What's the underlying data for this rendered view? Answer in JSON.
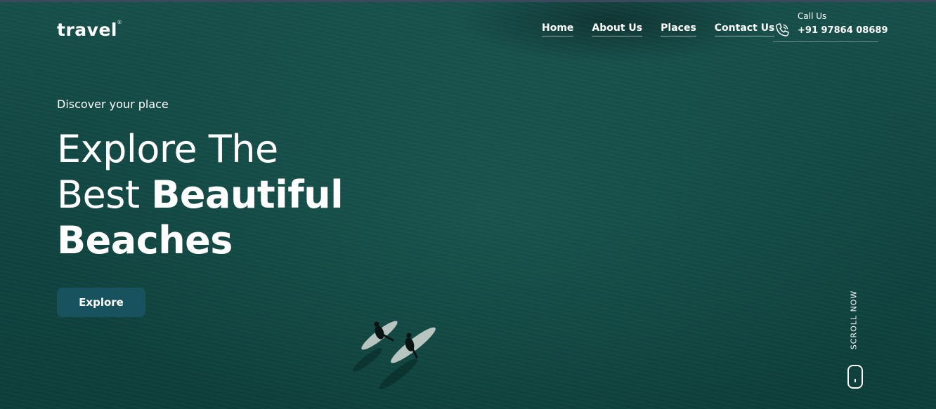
{
  "brand": {
    "logo_text": "travel",
    "registered_mark": "®"
  },
  "nav": {
    "items": [
      {
        "label": "Home"
      },
      {
        "label": "About Us"
      },
      {
        "label": "Places"
      },
      {
        "label": "Contact Us"
      }
    ]
  },
  "contact": {
    "label": "Call Us",
    "phone": "+91 97864 08689"
  },
  "hero": {
    "eyebrow": "Discover your place",
    "headline_line1": "Explore The",
    "headline_line2_light": "Best ",
    "headline_line2_bold": "Beautiful",
    "headline_line3_bold": "Beaches",
    "cta_label": "Explore"
  },
  "scroll": {
    "label": "SCROLL NOW"
  },
  "icons": {
    "phone": "phone-icon",
    "mouse": "mouse-icon"
  },
  "colors": {
    "sea": "#114642",
    "button": "#17525e",
    "text": "#ffffff"
  }
}
